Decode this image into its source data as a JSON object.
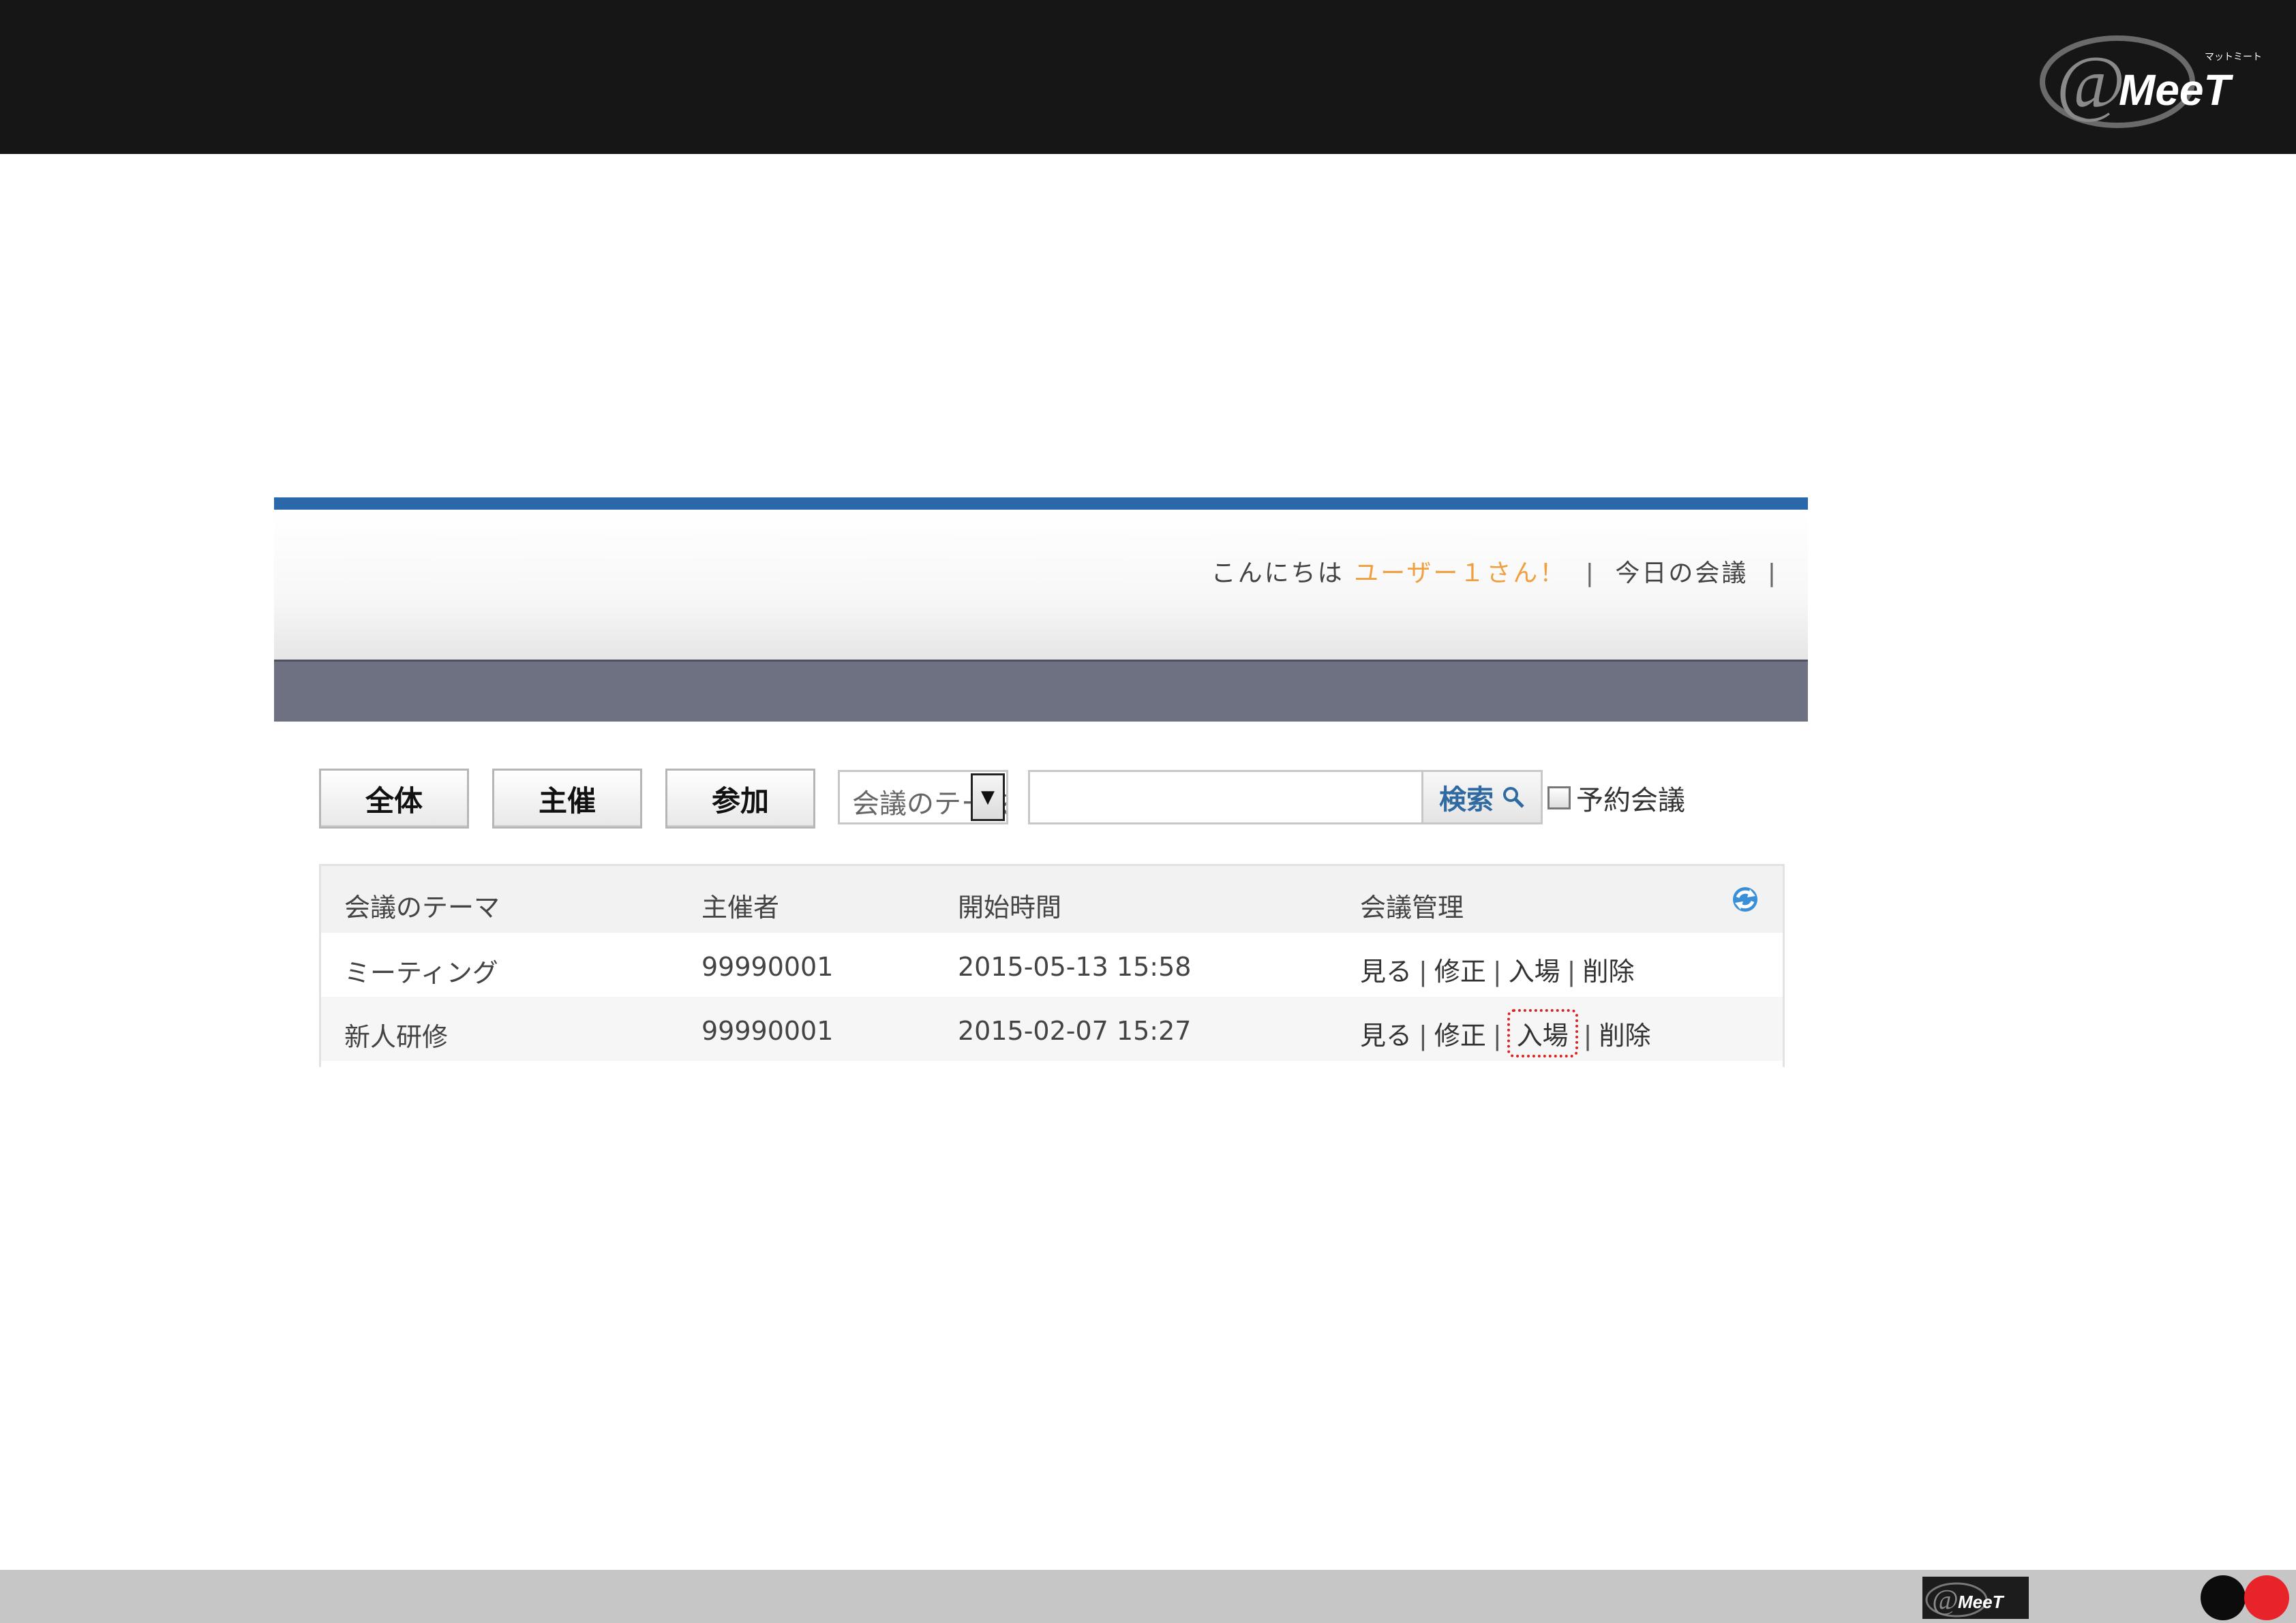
{
  "brand": {
    "logo_text": "MeeT",
    "logo_small": "マットミート",
    "logo_glyph": "@"
  },
  "header": {
    "greeting_prefix": "こんにちは",
    "user_name": "ユーザー１さん！",
    "separator": "|",
    "today_meetings_link": "今日の会議"
  },
  "toolbar": {
    "all_button": "全体",
    "host_button": "主催",
    "join_button": "参加",
    "search_field_select": "会議のテーマ",
    "search_input_value": "",
    "search_button": "検索",
    "reserved_checkbox_label": "予約会議",
    "reserved_checked": false
  },
  "table": {
    "headers": [
      "会議のテーマ",
      "主催者",
      "開始時間",
      "会議管理"
    ],
    "rows": [
      {
        "theme": "ミーティング",
        "host": "99990001",
        "start": "2015-05-13 15:58"
      },
      {
        "theme": "新人研修",
        "host": "99990001",
        "start": "2015-02-07 15:27"
      }
    ],
    "actions": {
      "view": "見る",
      "edit": "修正",
      "enter": "入場",
      "delete": "削除"
    }
  },
  "colors": {
    "top_bar": "#161616",
    "accent_blue": "#2b68a9",
    "username_orange": "#f0a040",
    "highlight_red": "#d22222",
    "footer_gray": "#c6c6c6"
  }
}
